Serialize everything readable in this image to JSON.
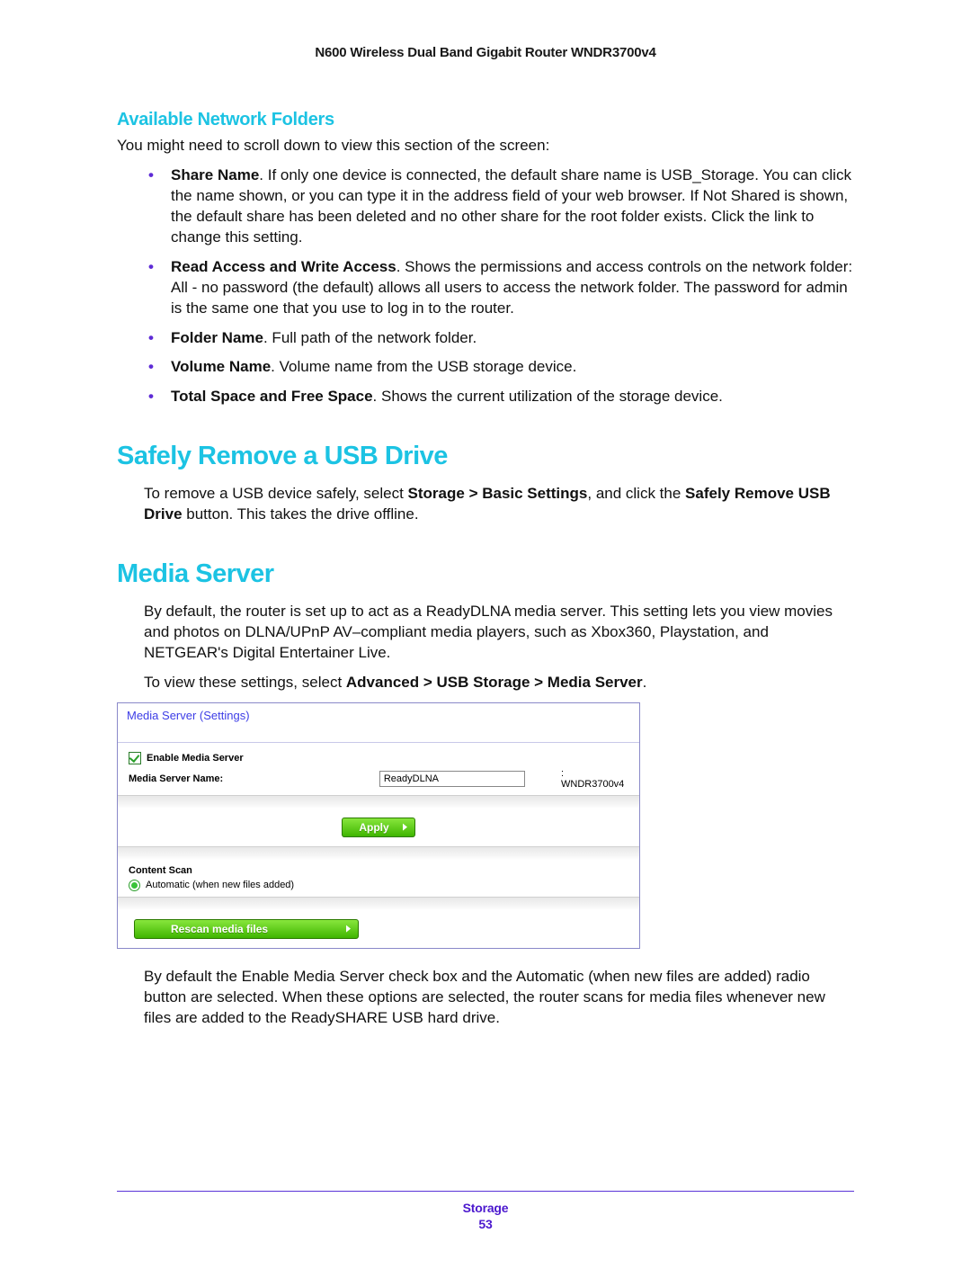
{
  "doc": {
    "header": "N600 Wireless Dual Band Gigabit Router WNDR3700v4",
    "footer_label": "Storage",
    "page_number": "53"
  },
  "sections": {
    "folders_title": "Available Network Folders",
    "folders_intro": "You might need to scroll down to view this section of the screen:",
    "bullets": {
      "share_name_label": "Share Name",
      "share_name_text": ". If only one device is connected, the default share name is USB_Storage. You can click the name shown, or you can type it in the address field of your web browser. If Not Shared is shown, the default share has been deleted and no other share for the root folder exists. Click the link to change this setting.",
      "rw_label": "Read Access and Write Access",
      "rw_text": ". Shows the permissions and access controls on the network folder: All - no password (the default) allows all users to access the network folder. The password for admin is the same one that you use to log in to the router.",
      "folder_label": "Folder Name",
      "folder_text": ". Full path of the network folder.",
      "volume_label": "Volume Name",
      "volume_text": ". Volume name from the USB storage device.",
      "space_label": "Total Space and Free Space",
      "space_text": ". Shows the current utilization of the storage device."
    },
    "safely_title": "Safely Remove a USB Drive",
    "safely_pre": "To remove a USB device safely, select ",
    "safely_path": "Storage > Basic Settings",
    "safely_mid": ", and click the ",
    "safely_btn": "Safely Remove USB Drive",
    "safely_post": " button. This takes the drive offline.",
    "media_title": "Media Server",
    "media_p1": "By default, the router is set up to act as a ReadyDLNA media server. This setting lets you view movies and photos on DLNA/UPnP AV–compliant media players, such as Xbox360, Playstation, and NETGEAR's Digital Entertainer Live.",
    "media_p2_pre": "To view these settings, select ",
    "media_p2_path": "Advanced > USB Storage > Media Server",
    "media_p2_post": ".",
    "media_p3": "By default the Enable Media Server check box and the Automatic (when new files are added) radio button are selected. When these options are selected, the router scans for media files whenever new files are added to the ReadySHARE USB hard drive."
  },
  "panel": {
    "title": "Media Server (Settings)",
    "enable_label": "Enable Media Server",
    "name_label": "Media Server Name:",
    "name_value": "ReadyDLNA",
    "suffix": ": WNDR3700v4",
    "apply_label": "Apply",
    "scan_label": "Content Scan",
    "auto_label": "Automatic (when new files added)",
    "rescan_label": "Rescan media files"
  }
}
